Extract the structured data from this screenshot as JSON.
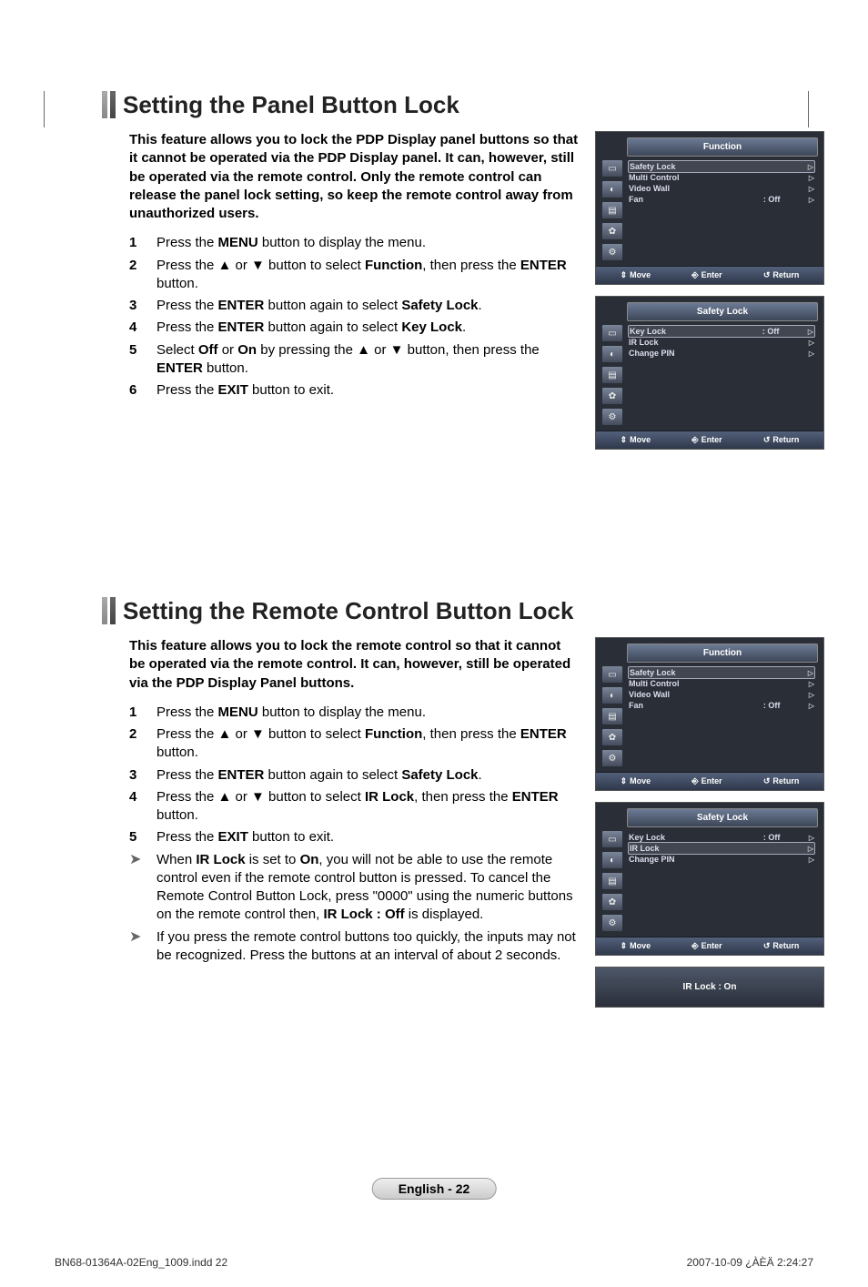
{
  "section1": {
    "title": "Setting the Panel Button Lock",
    "intro": "This feature allows you to lock the PDP Display panel buttons so that it cannot be operated via the PDP Display panel. It can, however, still be operated via the remote control. Only the remote control can release the panel lock setting, so keep the remote control away from unauthorized users.",
    "steps": [
      {
        "n": "1",
        "html": "Press the <b>MENU</b> button to display the menu."
      },
      {
        "n": "2",
        "html": "Press the ▲ or ▼ button to select <b>Function</b>, then press the <b>ENTER</b> button."
      },
      {
        "n": "3",
        "html": "Press the <b>ENTER</b> button again to select <b>Safety Lock</b>."
      },
      {
        "n": "4",
        "html": "Press the <b>ENTER</b> button again to select <b>Key Lock</b>."
      },
      {
        "n": "5",
        "html": "Select <b>Off</b> or <b>On</b> by pressing the ▲ or ▼ button, then press the <b>ENTER</b> button."
      },
      {
        "n": "6",
        "html": "Press the <b>EXIT</b> button to exit."
      }
    ],
    "osd1": {
      "title": "Function",
      "rows": [
        {
          "label": "Safety Lock",
          "val": "",
          "sel": true
        },
        {
          "label": "Multi Control",
          "val": ""
        },
        {
          "label": "Video Wall",
          "val": ""
        },
        {
          "label": "Fan",
          "val": ": Off"
        }
      ],
      "foot": {
        "move": "Move",
        "enter": "Enter",
        "return": "Return"
      }
    },
    "osd2": {
      "title": "Safety Lock",
      "rows": [
        {
          "label": "Key Lock",
          "val": ": Off",
          "sel": true
        },
        {
          "label": "IR Lock",
          "val": ""
        },
        {
          "label": "Change PIN",
          "val": ""
        }
      ],
      "foot": {
        "move": "Move",
        "enter": "Enter",
        "return": "Return"
      }
    }
  },
  "section2": {
    "title": "Setting the Remote Control Button Lock",
    "intro": "This feature allows you to lock the remote control so that it cannot be operated via the remote control. It can, however, still be operated via the PDP Display Panel buttons.",
    "steps": [
      {
        "n": "1",
        "html": "Press the <b>MENU</b> button to display the menu."
      },
      {
        "n": "2",
        "html": "Press the ▲ or ▼ button to select <b>Function</b>, then press the <b>ENTER</b> button."
      },
      {
        "n": "3",
        "html": "Press the <b>ENTER</b> button again to select <b>Safety Lock</b>."
      },
      {
        "n": "4",
        "html": "Press the ▲ or ▼ button to select <b>IR Lock</b>, then press the <b>ENTER</b> button."
      },
      {
        "n": "5",
        "html": "Press the <b>EXIT</b> button to exit."
      }
    ],
    "notes": [
      {
        "html": "When <b>IR Lock</b> is set to <b>On</b>, you will not be able to use the remote control even if the remote control button is pressed. To cancel the Remote Control Button Lock, press \"0000\" using the numeric buttons on the remote control then, <b>IR Lock : Off</b> is displayed."
      },
      {
        "html": "If you press the remote control buttons too quickly, the inputs may not be recognized. Press the buttons at an interval of about 2 seconds."
      }
    ],
    "osd1": {
      "title": "Function",
      "rows": [
        {
          "label": "Safety Lock",
          "val": "",
          "sel": true
        },
        {
          "label": "Multi Control",
          "val": ""
        },
        {
          "label": "Video Wall",
          "val": ""
        },
        {
          "label": "Fan",
          "val": ": Off"
        }
      ],
      "foot": {
        "move": "Move",
        "enter": "Enter",
        "return": "Return"
      }
    },
    "osd2": {
      "title": "Safety Lock",
      "rows": [
        {
          "label": "Key Lock",
          "val": ": Off"
        },
        {
          "label": "IR Lock",
          "val": "",
          "sel": true
        },
        {
          "label": "Change PIN",
          "val": ""
        }
      ],
      "foot": {
        "move": "Move",
        "enter": "Enter",
        "return": "Return"
      }
    },
    "banner": "IR Lock : On"
  },
  "footer": {
    "pill": "English - 22",
    "left": "BN68-01364A-02Eng_1009.indd   22",
    "right": "2007-10-09   ¿ÀÈÄ 2:24:27"
  }
}
